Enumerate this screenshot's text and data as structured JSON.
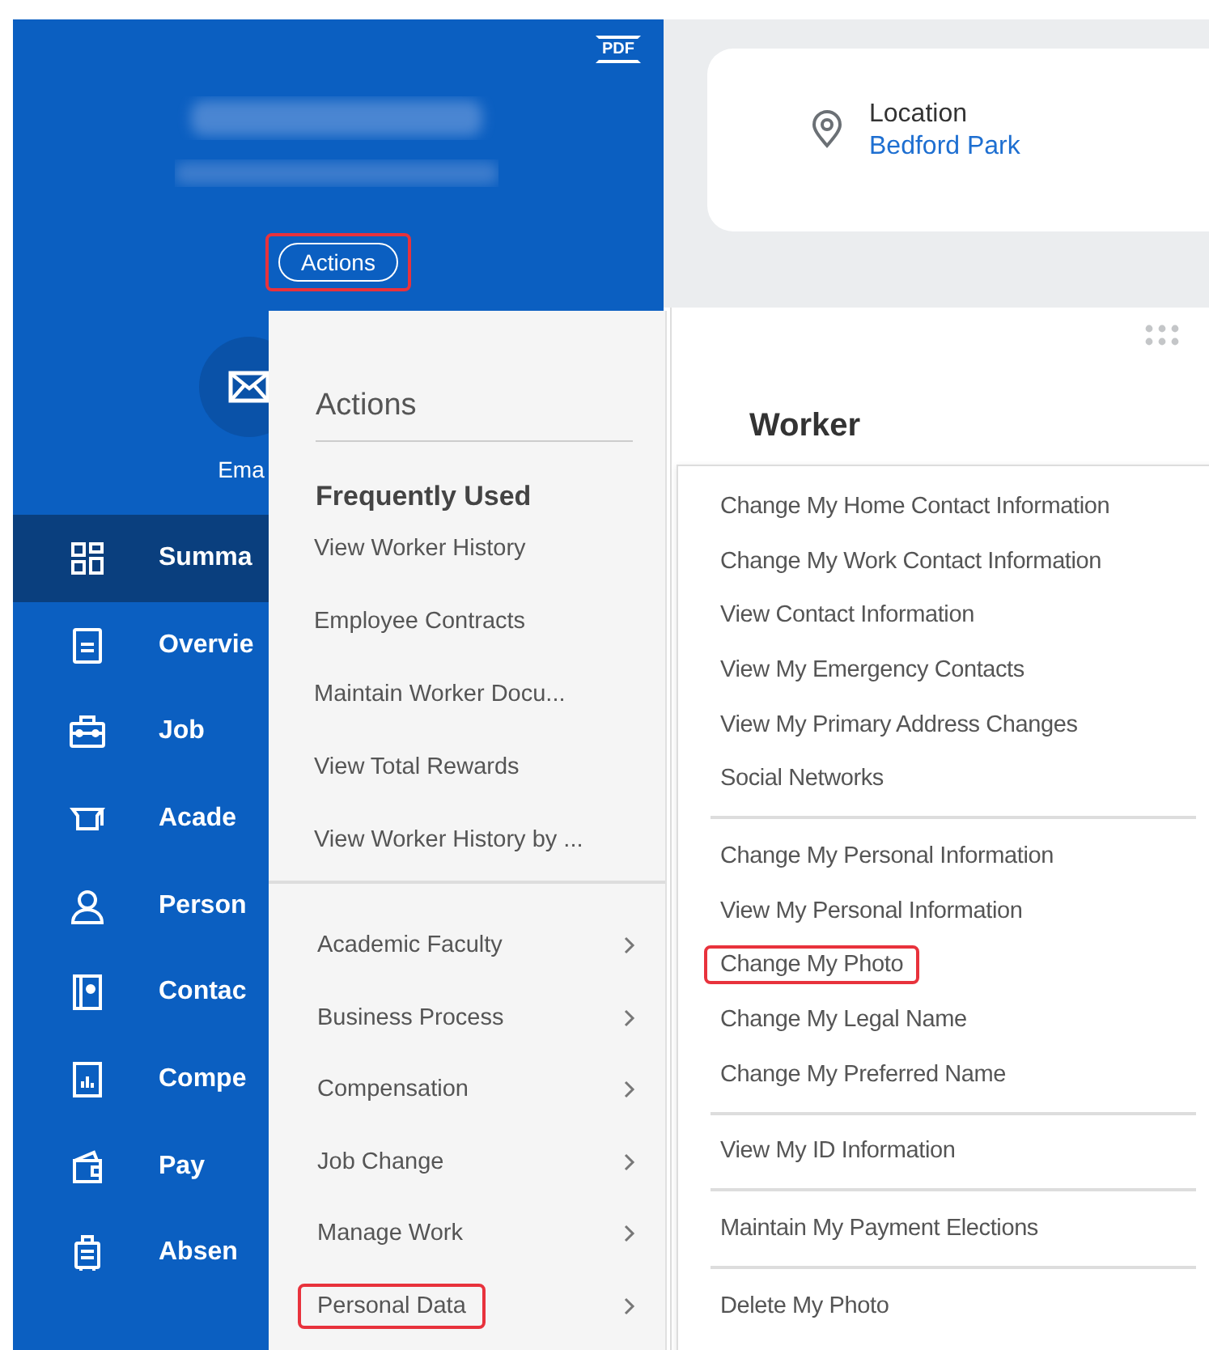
{
  "header": {
    "pdf_label": "PDF",
    "actions_button": {
      "label": "Actions",
      "highlighted": true
    },
    "email_label": "Ema"
  },
  "nav": [
    {
      "label": "Summa",
      "selected": true
    },
    {
      "label": "Overvie",
      "selected": false
    },
    {
      "label": "Job",
      "selected": false
    },
    {
      "label": "Acade",
      "selected": false
    },
    {
      "label": "Person",
      "selected": false
    },
    {
      "label": "Contac",
      "selected": false
    },
    {
      "label": "Compe",
      "selected": false
    },
    {
      "label": "Pay",
      "selected": false
    },
    {
      "label": "Absen",
      "selected": false
    }
  ],
  "location": {
    "label": "Location",
    "value": "Bedford Park"
  },
  "worker_heading": "Worker",
  "actions_menu": {
    "title": "Actions",
    "section": "Frequently Used",
    "frequent": [
      {
        "label": "View Worker History"
      },
      {
        "label": "Employee Contracts"
      },
      {
        "label": "Maintain Worker Docu..."
      },
      {
        "label": "View Total Rewards"
      },
      {
        "label": "View Worker History by ..."
      }
    ],
    "categories": [
      {
        "label": "Academic Faculty",
        "highlighted": false
      },
      {
        "label": "Business Process",
        "highlighted": false
      },
      {
        "label": "Compensation",
        "highlighted": false
      },
      {
        "label": "Job Change",
        "highlighted": false
      },
      {
        "label": "Manage Work",
        "highlighted": false
      },
      {
        "label": "Personal Data",
        "highlighted": true
      }
    ]
  },
  "submenu": {
    "groups": [
      {
        "items": [
          {
            "label": "Change My Home Contact Information",
            "highlighted": false
          },
          {
            "label": "Change My Work Contact Information",
            "highlighted": false
          },
          {
            "label": "View Contact Information",
            "highlighted": false
          },
          {
            "label": "View My Emergency Contacts",
            "highlighted": false
          },
          {
            "label": "View My Primary Address Changes",
            "highlighted": false
          },
          {
            "label": "Social Networks",
            "highlighted": false
          }
        ]
      },
      {
        "items": [
          {
            "label": "Change My Personal Information",
            "highlighted": false
          },
          {
            "label": "View My Personal Information",
            "highlighted": false
          },
          {
            "label": "Change My Photo",
            "highlighted": true
          },
          {
            "label": "Change My Legal Name",
            "highlighted": false
          },
          {
            "label": "Change My Preferred Name",
            "highlighted": false
          }
        ]
      },
      {
        "items": [
          {
            "label": "View My ID Information",
            "highlighted": false
          }
        ]
      },
      {
        "items": [
          {
            "label": "Maintain My Payment Elections",
            "highlighted": false
          }
        ]
      },
      {
        "items": [
          {
            "label": "Delete My Photo",
            "highlighted": false
          }
        ]
      }
    ]
  }
}
